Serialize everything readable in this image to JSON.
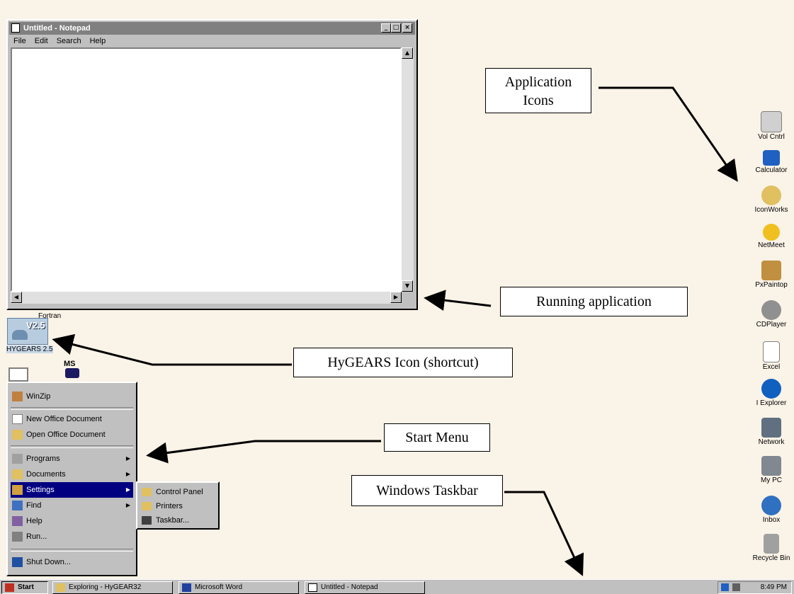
{
  "notepad": {
    "title": "Untitled - Notepad",
    "menu": [
      "File",
      "Edit",
      "Search",
      "Help"
    ],
    "controls": {
      "minimize": "_",
      "maximize": "□",
      "close": "×"
    }
  },
  "callouts": {
    "app_icons": [
      "Application",
      "Icons"
    ],
    "running_app": "Running application",
    "hygears_icon": "HyGEARS Icon (shortcut)",
    "start_menu": "Start Menu",
    "taskbar": "Windows Taskbar"
  },
  "desktop_left": {
    "hygears_label": "HYGEARS 2.5",
    "hygears_badge": "V2.5",
    "fortran_label": "Fortran",
    "ms_label": "MS"
  },
  "desktop_icons": [
    {
      "label": "Vol Cntrl",
      "icon": "volume-control-icon"
    },
    {
      "label": "Calculator",
      "icon": "calculator-icon"
    },
    {
      "label": "IconWorks",
      "icon": "iconworks-icon"
    },
    {
      "label": "NetMeet",
      "icon": "netmeeting-icon"
    },
    {
      "label": "PxPaintop",
      "icon": "paint-icon"
    },
    {
      "label": "CDPlayer",
      "icon": "cd-player-icon"
    },
    {
      "label": "Excel",
      "icon": "excel-icon"
    },
    {
      "label": "I Explorer",
      "icon": "internet-explorer-icon"
    },
    {
      "label": "Network",
      "icon": "network-icon"
    },
    {
      "label": "My PC",
      "icon": "my-computer-icon"
    },
    {
      "label": "Inbox",
      "icon": "inbox-icon"
    },
    {
      "label": "Recycle Bin",
      "icon": "recycle-bin-icon"
    }
  ],
  "start_menu": {
    "items": [
      {
        "label": "WinZip",
        "icon": "winzip-icon"
      },
      {
        "label": "New Office Document",
        "icon": "new-document-icon"
      },
      {
        "label": "Open Office Document",
        "icon": "open-folder-icon"
      },
      {
        "label": "Programs",
        "icon": "programs-icon",
        "arrow": "▶"
      },
      {
        "label": "Documents",
        "icon": "documents-icon",
        "arrow": "▶"
      },
      {
        "label": "Settings",
        "icon": "settings-icon",
        "arrow": "▶"
      },
      {
        "label": "Find",
        "icon": "find-icon",
        "arrow": "▶"
      },
      {
        "label": "Help",
        "icon": "help-icon"
      },
      {
        "label": "Run...",
        "icon": "run-icon"
      },
      {
        "label": "Shut Down...",
        "icon": "shutdown-icon"
      }
    ],
    "settings_submenu": [
      {
        "label": "Control Panel",
        "icon": "control-panel-icon"
      },
      {
        "label": "Printers",
        "icon": "printers-icon"
      },
      {
        "label": "Taskbar...",
        "icon": "taskbar-icon"
      }
    ]
  },
  "taskbar": {
    "start_label": "Start",
    "buttons": [
      {
        "label": "Exploring - HyGEAR32",
        "icon": "explorer-icon"
      },
      {
        "label": "Microsoft Word",
        "icon": "word-icon"
      },
      {
        "label": "Untitled - Notepad",
        "icon": "notepad-icon"
      }
    ],
    "clock": "8:49 PM"
  }
}
